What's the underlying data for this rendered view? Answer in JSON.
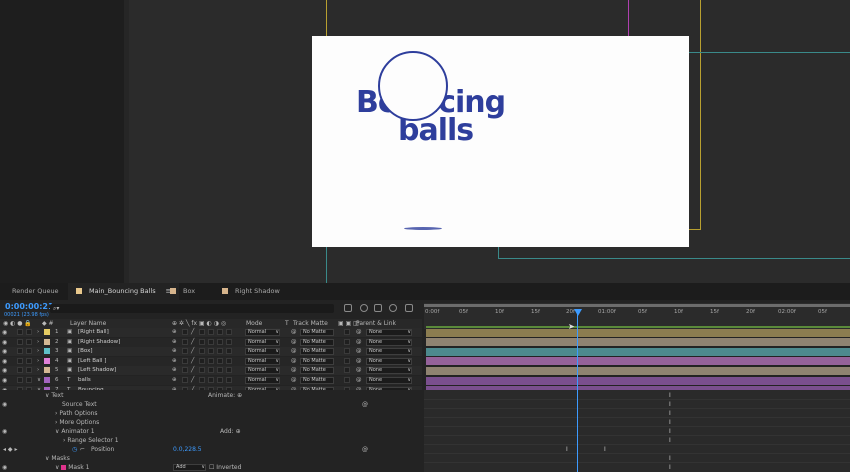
{
  "composition": {
    "title_line1": "Bouncing",
    "title_line2": "balls",
    "colors": {
      "brand_blue": "#2e3e9c",
      "canvas_bg": "#fdfdfd",
      "timecode_blue": "#3d9bff"
    }
  },
  "tabs": [
    {
      "label": "Render Queue",
      "color": ""
    },
    {
      "label": "Main_Bouncing Balls",
      "color": "#e8c88c"
    },
    {
      "label": "Box",
      "color": "#d6b48c"
    },
    {
      "label": "Right Shadow",
      "color": "#d6b48c"
    }
  ],
  "timeline": {
    "timecode": "0:00:00:21",
    "subtimecode": "00021 (23.98 fps)",
    "search_placeholder": "",
    "ruler_ticks": [
      "0:00f",
      "05f",
      "10f",
      "15f",
      "20f",
      "01:00f",
      "05f",
      "10f",
      "15f",
      "20f",
      "02:00f",
      "05f"
    ],
    "columns": {
      "layer_name": "Layer Name",
      "mode": "Mode",
      "t": "T",
      "track_matte": "Track Matte",
      "parent_link": "Parent & Link"
    }
  },
  "layers": [
    {
      "num": "1",
      "name": "[Right Ball]",
      "color": "#e6cc63",
      "mode": "Normal",
      "matte": "No Matte",
      "parent": "None",
      "bar": "#8c7d50"
    },
    {
      "num": "2",
      "name": "[Right Shadow]",
      "color": "#d4b894",
      "mode": "Normal",
      "matte": "No Matte",
      "parent": "None",
      "bar": "#8f8371"
    },
    {
      "num": "3",
      "name": "[Box]",
      "color": "#5fc0c8",
      "mode": "Normal",
      "matte": "No Matte",
      "parent": "None",
      "bar": "#4d8a8e"
    },
    {
      "num": "4",
      "name": "[Left Ball ]",
      "color": "#e080d8",
      "mode": "Normal",
      "matte": "No Matte",
      "parent": "None",
      "bar": "#95629a"
    },
    {
      "num": "5",
      "name": "[Left Shadow]",
      "color": "#d4b894",
      "mode": "Normal",
      "matte": "No Matte",
      "parent": "None",
      "bar": "#8f8371"
    },
    {
      "num": "6",
      "name": "balls",
      "color": "#a464c0",
      "mode": "Normal",
      "matte": "No Matte",
      "parent": "None",
      "bar": "#7a4f8e"
    },
    {
      "num": "7",
      "name": "Bouncing",
      "color": "#a464c0",
      "mode": "Normal",
      "matte": "No Matte",
      "parent": "None",
      "bar": "#7a4f8e"
    }
  ],
  "properties": {
    "text": "Text",
    "animate": "Animate:",
    "source_text": "Source Text",
    "path_options": "Path Options",
    "more_options": "More Options",
    "animator1": "Animator 1",
    "add": "Add:",
    "range_selector": "Range Selector 1",
    "position": "Position",
    "position_value": "0.0,228.5",
    "masks": "Masks",
    "mask1": "Mask 1",
    "mask_mode": "Add",
    "inverted": "Inverted"
  }
}
